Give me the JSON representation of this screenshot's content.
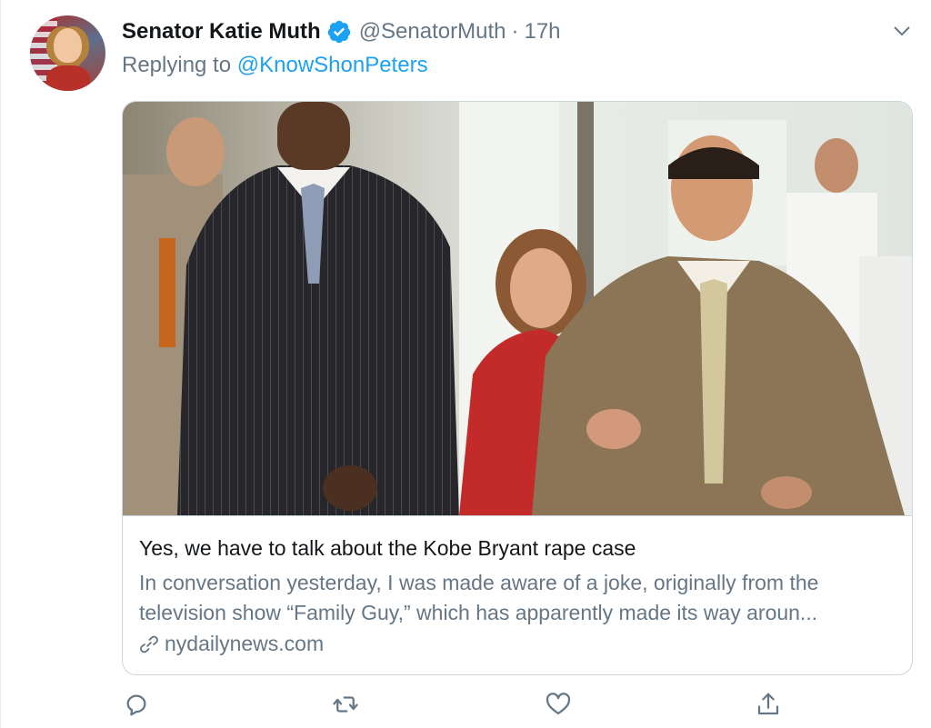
{
  "tweet": {
    "author_name": "Senator Katie Muth",
    "handle": "@SenatorMuth",
    "separator": "·",
    "time": "17h",
    "replying_prefix": "Replying to",
    "replying_to": "@KnowShonPeters"
  },
  "card": {
    "title": "Yes, we have to talk about the Kobe Bryant rape case",
    "description": "In conversation yesterday, I was made aware of a joke, originally from the television show “Family Guy,” which has apparently made its way aroun...",
    "domain": "nydailynews.com"
  },
  "icons": {
    "verified": "verified-badge-icon",
    "menu": "chevron-down-icon",
    "link": "link-icon",
    "reply": "reply-icon",
    "retweet": "retweet-icon",
    "like": "heart-icon",
    "share": "share-icon"
  },
  "colors": {
    "accent": "#1da1f2",
    "muted": "#657786",
    "text": "#14171a",
    "border": "#ccd6dd"
  }
}
